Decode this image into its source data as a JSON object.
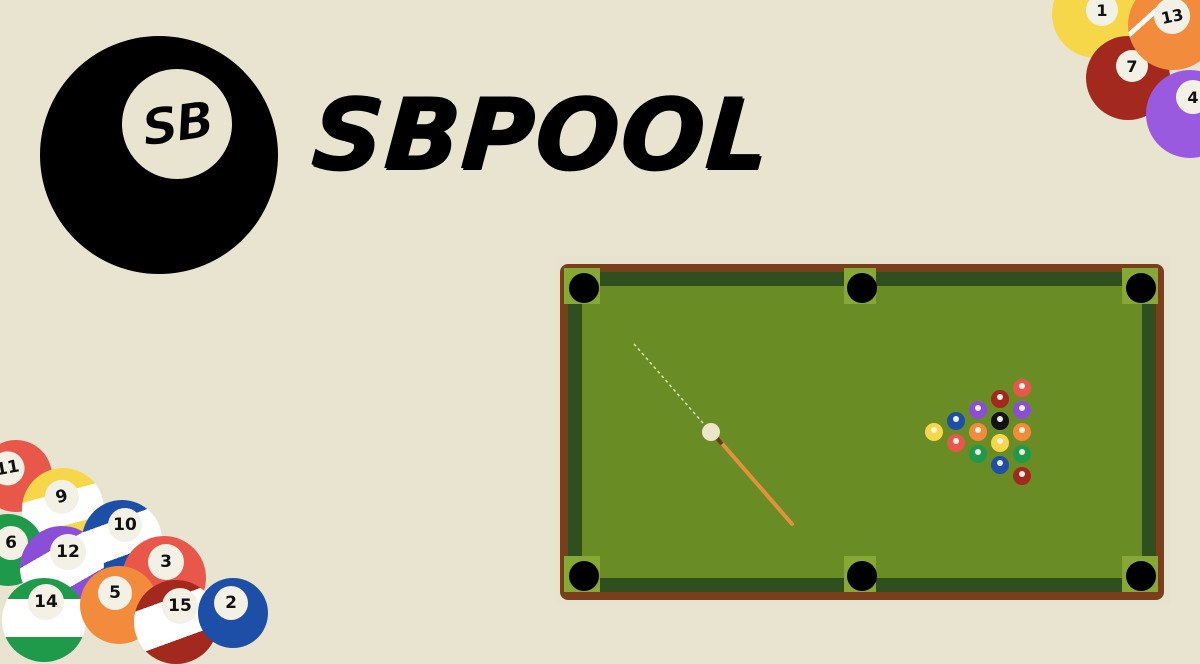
{
  "brand": {
    "title": "SBPOOL",
    "logo_text": "SB"
  },
  "colors": {
    "background": "#e8e4d0",
    "felt": "#6a8c24",
    "rail": "#2f4f1e",
    "frame": "#7a3e1a"
  },
  "corner_balls_bottom_left": [
    {
      "number": "11",
      "color": "#e8574a"
    },
    {
      "number": "9",
      "color": "#f7d74a"
    },
    {
      "number": "10",
      "color": "#1d4fa8"
    },
    {
      "number": "6",
      "color": "#1f9a4a"
    },
    {
      "number": "12",
      "color": "#8a4fd6"
    },
    {
      "number": "3",
      "color": "#e8574a"
    },
    {
      "number": "14",
      "color": "#1f9a4a"
    },
    {
      "number": "5",
      "color": "#f28c3c"
    },
    {
      "number": "15",
      "color": "#a3281e"
    },
    {
      "number": "2",
      "color": "#1d4fa8"
    }
  ],
  "corner_balls_top_right": [
    {
      "number": "1",
      "color": "#f7d74a"
    },
    {
      "number": "13",
      "color": "#f28c3c"
    },
    {
      "number": "7",
      "color": "#a3281e"
    },
    {
      "number": "4",
      "color": "#9a5ae0"
    }
  ],
  "game": {
    "icons": {
      "cue_ball": "cue-ball-icon",
      "cue_stick": "cue-stick-icon",
      "pocket": "pocket-icon"
    }
  }
}
